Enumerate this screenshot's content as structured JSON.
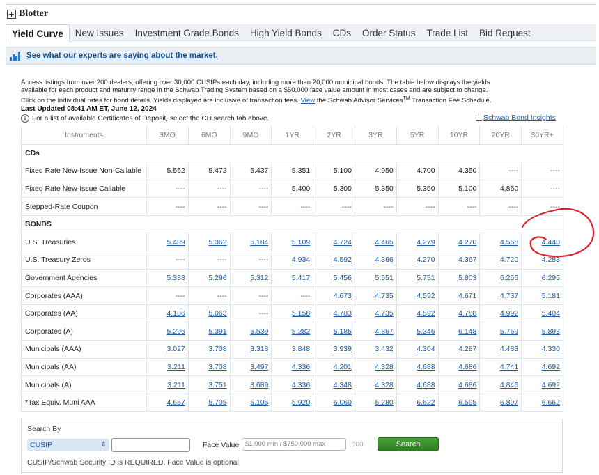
{
  "header": {
    "title": "Blotter"
  },
  "tabs": [
    {
      "label": "Yield Curve",
      "active": true
    },
    {
      "label": "New Issues"
    },
    {
      "label": "Investment Grade Bonds"
    },
    {
      "label": "High Yield Bonds"
    },
    {
      "label": "CDs"
    },
    {
      "label": "Order Status"
    },
    {
      "label": "Trade List"
    },
    {
      "label": "Bid Request"
    }
  ],
  "banner": {
    "link": "See what our experts are saying about the market."
  },
  "description": {
    "line1": "Access listings from over 200 dealers, offering over 30,000 CUSIPs each day, including more than 20,000 municipal bonds. The table below displays the yields",
    "line2": "available for each product and maturity range in the Schwab Trading System based on a $50,000 face value amount in most cases and are subject to change.",
    "line3a": "Click on the individual rates for bond details. Yields displayed are inclusive of transaction fees.",
    "view_link": "View",
    "line3b": "the Schwab Advisor Services",
    "tm": "TM",
    "line3c": "Transaction Fee Schedule."
  },
  "last_updated": "Last Updated 08:41 AM ET, June 12, 2024",
  "cd_note": "For a list of available Certificates of Deposit, select the CD search tab above.",
  "insights_link": "Schwab Bond Insights",
  "table": {
    "headers": [
      "Instruments",
      "3MO",
      "6MO",
      "9MO",
      "1YR",
      "2YR",
      "3YR",
      "5YR",
      "10YR",
      "20YR",
      "30YR+"
    ],
    "sections": [
      {
        "title": "CDs",
        "linked": false,
        "rows": [
          {
            "name": "Fixed Rate New-Issue Non-Callable",
            "values": [
              "5.562",
              "5.472",
              "5.437",
              "5.351",
              "5.100",
              "4.950",
              "4.700",
              "4.350",
              "----",
              "----"
            ]
          },
          {
            "name": "Fixed Rate New-Issue Callable",
            "values": [
              "----",
              "----",
              "----",
              "5.400",
              "5.300",
              "5.350",
              "5.350",
              "5.100",
              "4.850",
              "----"
            ]
          },
          {
            "name": "Stepped-Rate Coupon",
            "values": [
              "----",
              "----",
              "----",
              "----",
              "----",
              "----",
              "----",
              "----",
              "----",
              "----"
            ]
          }
        ]
      },
      {
        "title": "BONDS",
        "linked": true,
        "rows": [
          {
            "name": "U.S. Treasuries",
            "values": [
              "5.409",
              "5.362",
              "5.184",
              "5.109",
              "4.724",
              "4.465",
              "4.279",
              "4.270",
              "4.568",
              "4.440"
            ]
          },
          {
            "name": "U.S. Treasury Zeros",
            "values": [
              "----",
              "----",
              "----",
              "4.934",
              "4.592",
              "4.366",
              "4.270",
              "4.367",
              "4.720",
              "4.283"
            ]
          },
          {
            "name": "Government Agencies",
            "values": [
              "5.338",
              "5.296",
              "5.312",
              "5.417",
              "5.456",
              "5.551",
              "5.751",
              "5.803",
              "6.256",
              "6.295"
            ]
          },
          {
            "name": "Corporates (AAA)",
            "values": [
              "----",
              "----",
              "----",
              "----",
              "4.673",
              "4.735",
              "4.592",
              "4.671",
              "4.737",
              "5.181"
            ]
          },
          {
            "name": "Corporates (AA)",
            "values": [
              "4.186",
              "5.063",
              "----",
              "5.158",
              "4.783",
              "4.735",
              "4.592",
              "4.788",
              "4.992",
              "5.404"
            ]
          },
          {
            "name": "Corporates (A)",
            "values": [
              "5.296",
              "5.391",
              "5.539",
              "5.282",
              "5.185",
              "4.867",
              "5.346",
              "6.148",
              "5.769",
              "5.893"
            ]
          },
          {
            "name": "Municipals (AAA)",
            "values": [
              "3.027",
              "3.708",
              "3.318",
              "3.848",
              "3.939",
              "3.432",
              "4.304",
              "4.287",
              "4.483",
              "4.330"
            ]
          },
          {
            "name": "Municipals (AA)",
            "values": [
              "3.211",
              "3.708",
              "3.497",
              "4.336",
              "4.201",
              "4.328",
              "4.688",
              "4.686",
              "4.741",
              "4.692"
            ]
          },
          {
            "name": "Municipals (A)",
            "values": [
              "3.211",
              "3.751",
              "3.689",
              "4.336",
              "4.348",
              "4.328",
              "4.688",
              "4.686",
              "4.846",
              "4.692"
            ]
          },
          {
            "name": "*Tax Equiv. Muni AAA",
            "values": [
              "4.657",
              "5.705",
              "5.105",
              "5.920",
              "6.060",
              "5.280",
              "6.622",
              "6.595",
              "6.897",
              "6.662"
            ]
          }
        ]
      }
    ]
  },
  "search": {
    "label": "Search By",
    "select_value": "CUSIP",
    "face_value_label": "Face Value",
    "face_value_placeholder": "$1,000 min / $750,000 max",
    "face_value_suffix": ".000",
    "button": "Search",
    "requirement_note": "CUSIP/Schwab Security ID is REQUIRED, Face Value is optional"
  },
  "colors": {
    "link": "#1c5aa6",
    "annotation": "#d8232a",
    "search_button": "#3a8f2c"
  }
}
